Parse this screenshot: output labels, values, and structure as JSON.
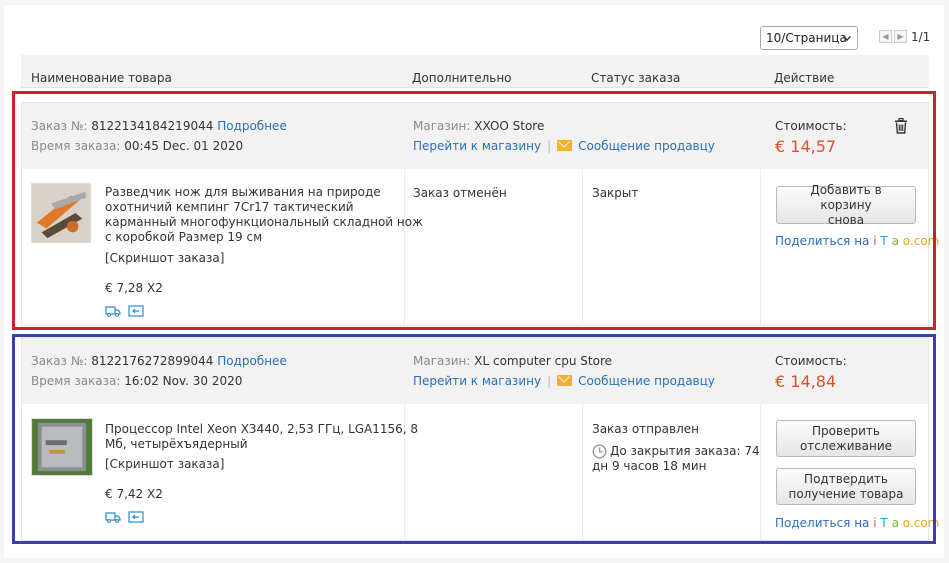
{
  "pagination": {
    "per_page": "10/Страница",
    "prev": "◀",
    "next": "▶",
    "page_count": "1/1"
  },
  "table_header": {
    "col_product": "Наименование товара",
    "col_extra": "Дополнительно",
    "col_status": "Статус заказа",
    "col_action": "Действие"
  },
  "orders": [
    {
      "order_no_label": "Заказ №:",
      "order_no": "8122134184219044",
      "details_link": "Подробнее",
      "time_label": "Время заказа:",
      "time": "00:45 Dec. 01 2020",
      "store_label": "Магазин:",
      "store": "XXOO Store",
      "go_store": "Перейти к магазину",
      "message_seller": "Сообщение продавцу",
      "cost_label": "Стоимость:",
      "cost": "€ 14,57",
      "item_title_lines": [
        "Разведчик нож для выживания на природе",
        "охотничий кемпинг 7Cr17 тактический",
        "карманный многофункциональный складной нож",
        "с коробкой Размер 19 см"
      ],
      "snapshot": "[Скриншот заказа]",
      "unit_price": "€ 7,28 X2",
      "extra_status": "Заказ отменён",
      "order_status": "Закрыт",
      "action_button_lines": [
        "Добавить в корзину",
        "снова"
      ],
      "share_prefix": "Поделиться на",
      "share_brand": {
        "i": "i",
        "t": "T",
        "a": "a",
        "o": "o.com"
      }
    },
    {
      "order_no_label": "Заказ №:",
      "order_no": "8122176272899044",
      "details_link": "Подробнее",
      "time_label": "Время заказа:",
      "time": "16:02 Nov. 30 2020",
      "store_label": "Магазин:",
      "store": "XL computer cpu Store",
      "go_store": "Перейти к магазину",
      "message_seller": "Сообщение продавцу",
      "cost_label": "Стоимость:",
      "cost": "€ 14,84",
      "item_title_lines": [
        "Процессор Intel Xeon X3440, 2,53 ГГц, LGA1156, 8",
        "Мб, четырёхъядерный"
      ],
      "snapshot": "[Скриншот заказа]",
      "unit_price": "€ 7,42 X2",
      "order_status": "Заказ отправлен",
      "countdown_lines": [
        "До закрытия заказа: 74",
        "дн 9 часов 18 мин"
      ],
      "track_button_lines": [
        "Проверить",
        "отслеживание"
      ],
      "confirm_button_lines": [
        "Подтвердить",
        "получение товара"
      ],
      "share_prefix": "Поделиться на",
      "share_brand": {
        "i": "i",
        "t": "T",
        "a": "a",
        "o": "o.com"
      }
    }
  ],
  "colors": {
    "price": "#e04e2c",
    "link": "#2a6fb5",
    "highlight_red": "#d0202a",
    "highlight_blue": "#3b3fa6"
  }
}
